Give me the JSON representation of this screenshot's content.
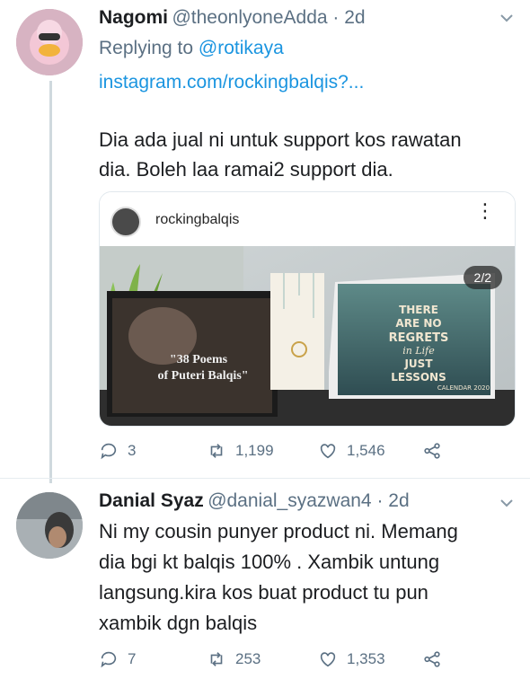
{
  "tweet1": {
    "display_name": "Nagomi",
    "handle_time": "@theonlyoneAdda · 2d",
    "replying_prefix": "Replying to",
    "replying_handle": "@rotikaya",
    "link": "instagram.com/rockingbalqis?...",
    "text_line1": "Dia ada jual ni untuk support kos rawatan",
    "text_line2": "dia. Boleh laa ramai2 support dia.",
    "card": {
      "ig_username": "rockingbalqis",
      "page_indicator": "2/2",
      "book_text_line1": "\"38 Poems",
      "book_text_line2": "of Puteri Balqis\"",
      "calendar_text_1": "THERE",
      "calendar_text_2": "ARE NO",
      "calendar_text_3": "REGRETS",
      "calendar_text_4": "in Life",
      "calendar_text_5": "JUST",
      "calendar_text_6": "LESSONS",
      "calendar_year": "CALENDAR 2020"
    },
    "actions": {
      "replies": "3",
      "retweets": "1,199",
      "likes": "1,546"
    }
  },
  "tweet2": {
    "display_name": "Danial Syaz",
    "handle_time": "@danial_syazwan4 · 2d",
    "text_line1": "Ni my cousin punyer product ni. Memang",
    "text_line2": "dia bgi kt balqis 100% . Xambik untung",
    "text_line3": "langsung.kira kos buat product tu pun",
    "text_line4": "xambik dgn balqis",
    "actions": {
      "replies": "7",
      "retweets": "253",
      "likes": "1,353"
    }
  },
  "colors": {
    "link": "#1b95e0",
    "secondary": "#5b7083",
    "thread": "#cfd9de"
  },
  "icons": [
    "reply-icon",
    "retweet-icon",
    "like-icon",
    "share-icon",
    "chevron-down-icon",
    "more-options-icon"
  ]
}
